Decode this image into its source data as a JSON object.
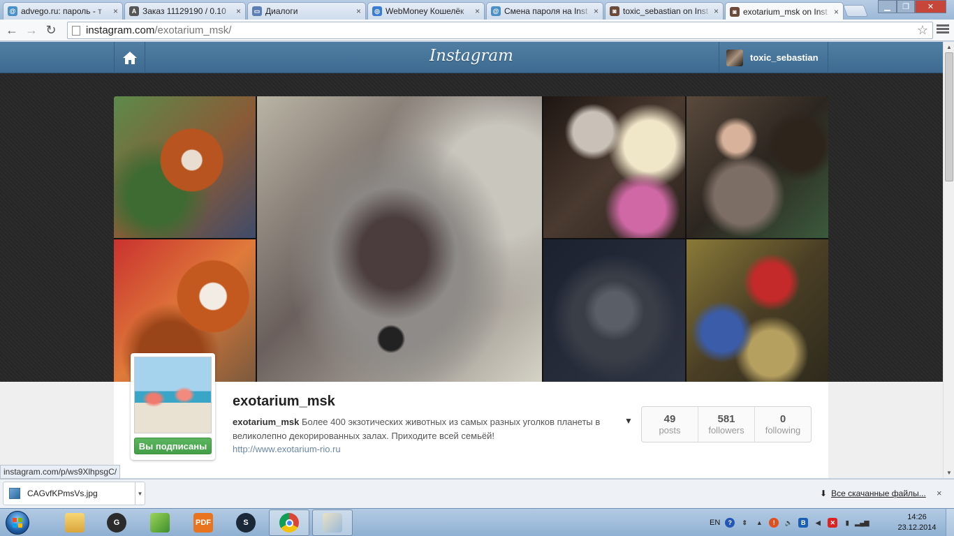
{
  "browser": {
    "tabs": [
      {
        "title": "advego.ru: пароль - т",
        "fav_color": "#4a90c8",
        "fav": "@"
      },
      {
        "title": "Заказ 11129190 / 0.10",
        "fav_color": "#555555",
        "fav": "A"
      },
      {
        "title": "Диалоги",
        "fav_color": "#5b7fb4",
        "fav": "▭"
      },
      {
        "title": "WebMoney Кошелёк",
        "fav_color": "#3a7bd5",
        "fav": "◎"
      },
      {
        "title": "Смена пароля на Inst",
        "fav_color": "#4a90c8",
        "fav": "@"
      },
      {
        "title": "toxic_sebastian on Inst",
        "fav_color": "#6b4a3a",
        "fav": "◙"
      },
      {
        "title": "exotarium_msk on Inst",
        "fav_color": "#6b4a3a",
        "fav": "◙"
      }
    ],
    "tab_close": "×",
    "url_host": "instagram.com",
    "url_path": "/exotarium_msk/",
    "status_url": "instagram.com/p/ws9XlhpsgC/"
  },
  "instagram": {
    "logo": "Instagram",
    "current_user": "toxic_sebastian",
    "profile": {
      "username": "exotarium_msk",
      "bio_name": "exotarium_msk",
      "bio_text": "Более 400 экзотических животных из самых разных уголков планеты в великолепно декорированных залах. Приходите всей семьёй!",
      "website": "http://www.exotarium-rio.ru",
      "follow_state": "Вы подписаны",
      "stats": [
        {
          "value": "49",
          "label": "posts"
        },
        {
          "value": "581",
          "label": "followers"
        },
        {
          "value": "0",
          "label": "following"
        }
      ]
    }
  },
  "downloads": {
    "file": "CAGvfKPmsVs.jpg",
    "all_label": "Все скачанные файлы...",
    "close": "×"
  },
  "taskbar": {
    "lang": "EN",
    "time": "14:26",
    "date": "23.12.2014"
  }
}
